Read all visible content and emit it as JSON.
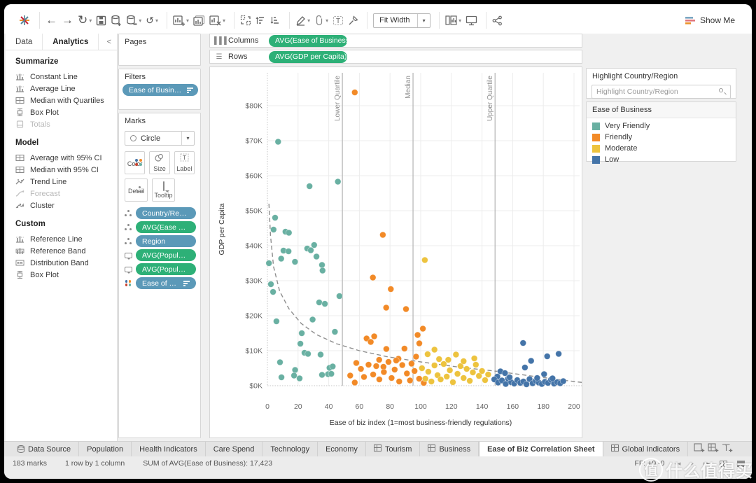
{
  "toolbar": {
    "fit_mode": "Fit Width",
    "show_me_label": "Show Me"
  },
  "analytics_pane": {
    "tabs": [
      {
        "label": "Data",
        "active": false
      },
      {
        "label": "Analytics",
        "active": true
      }
    ],
    "collapse_glyph": "<",
    "sections": [
      {
        "title": "Summarize",
        "items": [
          {
            "label": "Constant Line",
            "icon": "refline-icon",
            "disabled": false
          },
          {
            "label": "Average Line",
            "icon": "refline-icon",
            "disabled": false
          },
          {
            "label": "Median with Quartiles",
            "icon": "grid-icon",
            "disabled": false
          },
          {
            "label": "Box Plot",
            "icon": "boxplot-icon",
            "disabled": false
          },
          {
            "label": "Totals",
            "icon": "totals-icon",
            "disabled": true
          }
        ]
      },
      {
        "title": "Model",
        "items": [
          {
            "label": "Average with 95% CI",
            "icon": "grid-icon",
            "disabled": false
          },
          {
            "label": "Median with 95% CI",
            "icon": "grid-icon",
            "disabled": false
          },
          {
            "label": "Trend Line",
            "icon": "trend-icon",
            "disabled": false
          },
          {
            "label": "Forecast",
            "icon": "forecast-icon",
            "disabled": true
          },
          {
            "label": "Cluster",
            "icon": "cluster-icon",
            "disabled": false
          }
        ]
      },
      {
        "title": "Custom",
        "items": [
          {
            "label": "Reference Line",
            "icon": "refline-icon",
            "disabled": false
          },
          {
            "label": "Reference Band",
            "icon": "refband-icon",
            "disabled": false
          },
          {
            "label": "Distribution Band",
            "icon": "distband-icon",
            "disabled": false
          },
          {
            "label": "Box Plot",
            "icon": "boxplot-icon",
            "disabled": false
          }
        ]
      }
    ]
  },
  "cards": {
    "pages_title": "Pages",
    "filters_title": "Filters",
    "filter_pill": "Ease of Business (cl..",
    "marks_title": "Marks",
    "mark_type": "Circle",
    "mark_buttons_row1": [
      "Color",
      "Size",
      "Label"
    ],
    "mark_buttons_row2": [
      "Detail",
      "Tooltip"
    ],
    "mark_pills": [
      {
        "lead": "detail-icon",
        "label": "Country/Region",
        "color": "blue",
        "sort": false
      },
      {
        "lead": "detail-icon",
        "label": "AVG(Ease of Busi..",
        "color": "green",
        "sort": false
      },
      {
        "lead": "detail-icon",
        "label": "Region",
        "color": "blue",
        "sort": false
      },
      {
        "lead": "tooltip-icon",
        "label": "AVG(Population ..",
        "color": "green",
        "sort": false
      },
      {
        "lead": "tooltip-icon",
        "label": "AVG(Population ..",
        "color": "green",
        "sort": false
      },
      {
        "lead": "color-icon",
        "label": "Ease of Busine..",
        "color": "blue",
        "sort": true
      }
    ]
  },
  "shelves": {
    "columns_label": "Columns",
    "columns_pill": "AVG(Ease of Business)",
    "rows_label": "Rows",
    "rows_pill": "AVG(GDP per Capita)"
  },
  "right_panel": {
    "highlight_title": "Highlight Country/Region",
    "highlight_placeholder": "Highlight Country/Region",
    "legend_title": "Ease of Business"
  },
  "chart_data": {
    "type": "scatter",
    "title": "",
    "xlabel": "Ease of biz index (1=most business-friendly regulations)",
    "ylabel": "GDP per Capita",
    "xlim": [
      0,
      200
    ],
    "ylim_k": [
      0,
      80
    ],
    "x_ticks": [
      0,
      20,
      40,
      60,
      80,
      100,
      120,
      140,
      160,
      180,
      200
    ],
    "y_ticks_k": [
      0,
      10,
      20,
      30,
      40,
      50,
      60,
      70,
      80
    ],
    "y_tick_format": "$NK",
    "grid": true,
    "legend_position": "right",
    "reference_lines": [
      {
        "x": 48.9,
        "label": "Lower Quartile"
      },
      {
        "x": 95.0,
        "label": "Median"
      },
      {
        "x": 148.5,
        "label": "Upper Quartile"
      }
    ],
    "trend_line_k": [
      [
        1,
        52
      ],
      [
        2,
        43
      ],
      [
        4,
        34
      ],
      [
        8,
        27
      ],
      [
        14,
        22
      ],
      [
        22,
        17.8
      ],
      [
        32,
        14.6
      ],
      [
        45,
        12
      ],
      [
        60,
        10
      ],
      [
        78,
        8.3
      ],
      [
        100,
        6.8
      ],
      [
        125,
        5.3
      ],
      [
        150,
        4.1
      ],
      [
        175,
        2.6
      ],
      [
        200,
        1.2
      ],
      [
        206,
        0.9
      ]
    ],
    "series": [
      {
        "name": "Very Friendly",
        "color": "#69b0a2",
        "points": [
          [
            7,
            69.7
          ],
          [
            27.5,
            57
          ],
          [
            46,
            58.3
          ],
          [
            5,
            48
          ],
          [
            4,
            44.6
          ],
          [
            11.8,
            44
          ],
          [
            14,
            43.7
          ],
          [
            10.5,
            38.6
          ],
          [
            13.8,
            38.4
          ],
          [
            9,
            36.3
          ],
          [
            18,
            35.4
          ],
          [
            1,
            35
          ],
          [
            26,
            39.2
          ],
          [
            30.5,
            40.2
          ],
          [
            28.3,
            38.7
          ],
          [
            32,
            36.9
          ],
          [
            35.6,
            34.5
          ],
          [
            36,
            32.9
          ],
          [
            2.3,
            29
          ],
          [
            3.7,
            26.8
          ],
          [
            47,
            25.6
          ],
          [
            33.8,
            23.8
          ],
          [
            37.5,
            23.4
          ],
          [
            5.9,
            18.4
          ],
          [
            29.5,
            18.9
          ],
          [
            44,
            15.4
          ],
          [
            22.4,
            15
          ],
          [
            21.5,
            12
          ],
          [
            24.2,
            9.4
          ],
          [
            26.5,
            9.1
          ],
          [
            34.7,
            8.9
          ],
          [
            8.2,
            6.7
          ],
          [
            18.1,
            4.5
          ],
          [
            9.2,
            2.4
          ],
          [
            17.4,
            2.9
          ],
          [
            40.5,
            5.1
          ],
          [
            42.6,
            5.5
          ],
          [
            39.6,
            3.3
          ],
          [
            41.7,
            3.4
          ],
          [
            35.6,
            3.1
          ],
          [
            21,
            2.1
          ]
        ]
      },
      {
        "name": "Friendly",
        "color": "#f28a27",
        "points": [
          [
            57,
            83.8
          ],
          [
            75.3,
            43.1
          ],
          [
            68.8,
            30.9
          ],
          [
            80.5,
            27.6
          ],
          [
            77.5,
            22.3
          ],
          [
            90.4,
            21.9
          ],
          [
            101.4,
            16.3
          ],
          [
            98,
            14.5
          ],
          [
            69.7,
            14.1
          ],
          [
            64.7,
            13.5
          ],
          [
            67.4,
            12.5
          ],
          [
            99.1,
            12.1
          ],
          [
            89.4,
            10.6
          ],
          [
            77.6,
            10.5
          ],
          [
            85.5,
            7.7
          ],
          [
            72.9,
            7.4
          ],
          [
            75.7,
            5.4
          ],
          [
            58,
            6.5
          ],
          [
            61,
            4.8
          ],
          [
            63,
            2.5
          ],
          [
            66,
            6
          ],
          [
            69,
            3.2
          ],
          [
            71,
            5.6
          ],
          [
            73,
            1.8
          ],
          [
            76,
            3.9
          ],
          [
            79,
            6.8
          ],
          [
            81,
            2.2
          ],
          [
            83,
            4.6
          ],
          [
            86,
            1.2
          ],
          [
            88,
            5.9
          ],
          [
            91,
            3.5
          ],
          [
            93,
            1.5
          ],
          [
            96,
            4.2
          ],
          [
            99,
            2
          ],
          [
            102,
            0.8
          ],
          [
            54,
            2.9
          ],
          [
            57,
            0.9
          ],
          [
            94,
            6.3
          ],
          [
            97,
            8.3
          ],
          [
            84,
            7.2
          ]
        ]
      },
      {
        "name": "Moderate",
        "color": "#edc33e",
        "points": [
          [
            102.7,
            35.9
          ],
          [
            123,
            8.9
          ],
          [
            109,
            10.3
          ],
          [
            104.5,
            9
          ],
          [
            100.8,
            5
          ],
          [
            103,
            2
          ],
          [
            105,
            4
          ],
          [
            107,
            1.2
          ],
          [
            109,
            5.8
          ],
          [
            111,
            3
          ],
          [
            113,
            1.8
          ],
          [
            115,
            6.2
          ],
          [
            117,
            2.6
          ],
          [
            119,
            4.4
          ],
          [
            121,
            1
          ],
          [
            124,
            3.4
          ],
          [
            126,
            5.6
          ],
          [
            128,
            2.2
          ],
          [
            130,
            4.8
          ],
          [
            132,
            1.4
          ],
          [
            134,
            3.8
          ],
          [
            136,
            6
          ],
          [
            138,
            2.8
          ],
          [
            140,
            4.2
          ],
          [
            142,
            1.6
          ],
          [
            144,
            3.2
          ],
          [
            135,
            7.8
          ],
          [
            128,
            7
          ],
          [
            118,
            7.4
          ],
          [
            112,
            7.6
          ]
        ]
      },
      {
        "name": "Low",
        "color": "#4474a8",
        "points": [
          [
            166.8,
            12.2
          ],
          [
            190,
            9.1
          ],
          [
            182.5,
            8.4
          ],
          [
            172,
            7.1
          ],
          [
            168,
            5.2
          ],
          [
            180.5,
            3.3
          ],
          [
            152,
            4.1
          ],
          [
            155,
            3.6
          ],
          [
            150,
            2.6
          ],
          [
            148,
            1.8
          ],
          [
            150.5,
            0.9
          ],
          [
            153,
            1.5
          ],
          [
            155.5,
            0.5
          ],
          [
            157,
            2
          ],
          [
            159,
            1
          ],
          [
            161,
            0.6
          ],
          [
            163,
            1.6
          ],
          [
            165,
            0.8
          ],
          [
            167,
            1.2
          ],
          [
            169,
            0.4
          ],
          [
            171,
            1.9
          ],
          [
            173,
            0.7
          ],
          [
            175,
            1.4
          ],
          [
            177,
            0.9
          ],
          [
            179,
            0.5
          ],
          [
            181,
            1.1
          ],
          [
            183,
            0.8
          ],
          [
            185,
            1.7
          ],
          [
            187,
            0.6
          ],
          [
            189,
            1
          ],
          [
            191,
            0.7
          ],
          [
            193,
            1.3
          ],
          [
            158,
            2.4
          ],
          [
            176,
            2.2
          ],
          [
            186,
            2.1
          ]
        ]
      }
    ]
  },
  "bottom_tabs": {
    "data_source_label": "Data Source",
    "tabs": [
      {
        "label": "Population",
        "icon": false,
        "active": false
      },
      {
        "label": "Health Indicators",
        "icon": false,
        "active": false
      },
      {
        "label": "Care Spend",
        "icon": false,
        "active": false
      },
      {
        "label": "Technology",
        "icon": false,
        "active": false
      },
      {
        "label": "Economy",
        "icon": false,
        "active": false
      },
      {
        "label": "Tourism",
        "icon": true,
        "active": false
      },
      {
        "label": "Business",
        "icon": true,
        "active": false
      },
      {
        "label": "Ease of Biz Correlation Sheet",
        "icon": false,
        "active": true
      },
      {
        "label": "Global Indicators",
        "icon": true,
        "active": false
      }
    ]
  },
  "status_bar": {
    "marks_count": "183 marks",
    "grid_size": "1 row by 1 column",
    "aggregate": "SUM of AVG(Ease of Business): 17,423",
    "ff": "FF: +0 -0"
  },
  "watermark": {
    "logo_char": "值",
    "text": "什么值得买"
  }
}
